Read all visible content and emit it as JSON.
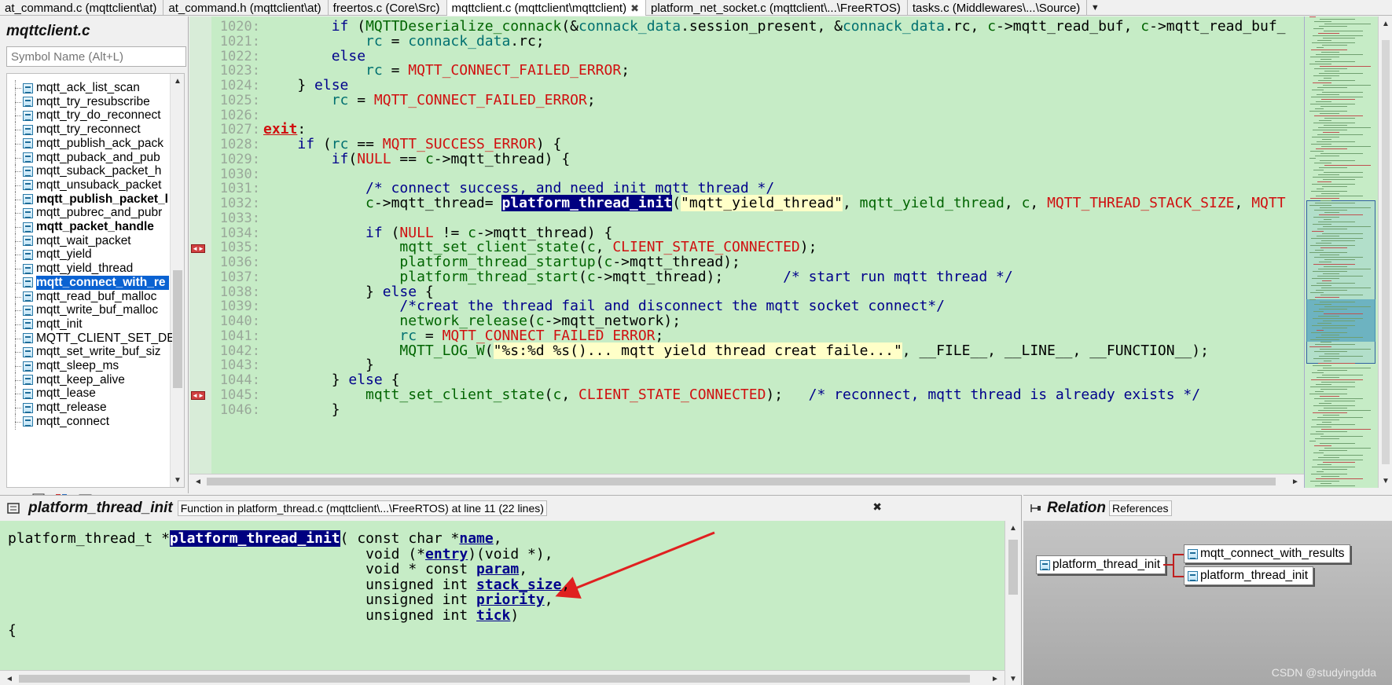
{
  "tabs": [
    {
      "label": "at_command.c (mqttclient\\at)",
      "active": false
    },
    {
      "label": "at_command.h (mqttclient\\at)",
      "active": false
    },
    {
      "label": "freertos.c (Core\\Src)",
      "active": false
    },
    {
      "label": "mqttclient.c (mqttclient\\mqttclient)",
      "active": true
    },
    {
      "label": "platform_net_socket.c (mqttclient\\...\\FreeRTOS)",
      "active": false
    },
    {
      "label": "tasks.c (Middlewares\\...\\Source)",
      "active": false
    }
  ],
  "tab_close_glyph": "✖",
  "tab_more_glyph": "▼",
  "symbol_panel": {
    "title": "mqttclient.c",
    "search_placeholder": "Symbol Name (Alt+L)",
    "items": [
      {
        "label": "mqtt_ack_list_scan",
        "bold": false,
        "selected": false
      },
      {
        "label": "mqtt_try_resubscribe",
        "bold": false,
        "selected": false
      },
      {
        "label": "mqtt_try_do_reconnect",
        "bold": false,
        "selected": false
      },
      {
        "label": "mqtt_try_reconnect",
        "bold": false,
        "selected": false
      },
      {
        "label": "mqtt_publish_ack_pack",
        "bold": false,
        "selected": false
      },
      {
        "label": "mqtt_puback_and_pub",
        "bold": false,
        "selected": false
      },
      {
        "label": "mqtt_suback_packet_h",
        "bold": false,
        "selected": false
      },
      {
        "label": "mqtt_unsuback_packet",
        "bold": false,
        "selected": false
      },
      {
        "label": "mqtt_publish_packet_l",
        "bold": true,
        "selected": false
      },
      {
        "label": "mqtt_pubrec_and_pubr",
        "bold": false,
        "selected": false
      },
      {
        "label": "mqtt_packet_handle",
        "bold": true,
        "selected": false
      },
      {
        "label": "mqtt_wait_packet",
        "bold": false,
        "selected": false
      },
      {
        "label": "mqtt_yield",
        "bold": false,
        "selected": false
      },
      {
        "label": "mqtt_yield_thread",
        "bold": false,
        "selected": false
      },
      {
        "label": "mqtt_connect_with_re",
        "bold": true,
        "selected": true
      },
      {
        "label": "mqtt_read_buf_malloc",
        "bold": false,
        "selected": false
      },
      {
        "label": "mqtt_write_buf_malloc",
        "bold": false,
        "selected": false
      },
      {
        "label": "mqtt_init",
        "bold": false,
        "selected": false
      },
      {
        "label": "MQTT_CLIENT_SET_DEF",
        "bold": false,
        "selected": false
      },
      {
        "label": "mqtt_set_write_buf_siz",
        "bold": false,
        "selected": false
      },
      {
        "label": "mqtt_sleep_ms",
        "bold": false,
        "selected": false
      },
      {
        "label": "mqtt_keep_alive",
        "bold": false,
        "selected": false
      },
      {
        "label": "mqtt_lease",
        "bold": false,
        "selected": false
      },
      {
        "label": "mqtt_release",
        "bold": false,
        "selected": false
      },
      {
        "label": "mqtt_connect",
        "bold": false,
        "selected": false
      }
    ],
    "toolbar": {
      "az_label": "A-Z"
    }
  },
  "editor": {
    "lines": [
      {
        "n": "1020:",
        "segs": [
          [
            "txt",
            "        "
          ],
          [
            "kw",
            "if"
          ],
          [
            "txt",
            " ("
          ],
          [
            "fn",
            "MQTTDeserialize_connack"
          ],
          [
            "txt",
            "(&"
          ],
          [
            "var",
            "connack_data"
          ],
          [
            "txt",
            ".session_present, &"
          ],
          [
            "var",
            "connack_data"
          ],
          [
            "txt",
            ".rc, "
          ],
          [
            "fn",
            "c"
          ],
          [
            "txt",
            "->mqtt_read_buf, "
          ],
          [
            "fn",
            "c"
          ],
          [
            "txt",
            "->mqtt_read_buf_"
          ]
        ]
      },
      {
        "n": "1021:",
        "segs": [
          [
            "txt",
            "            "
          ],
          [
            "var",
            "rc"
          ],
          [
            "txt",
            " = "
          ],
          [
            "var",
            "connack_data"
          ],
          [
            "txt",
            ".rc;"
          ]
        ]
      },
      {
        "n": "1022:",
        "segs": [
          [
            "txt",
            "        "
          ],
          [
            "kw",
            "else"
          ]
        ]
      },
      {
        "n": "1023:",
        "segs": [
          [
            "txt",
            "            "
          ],
          [
            "var",
            "rc"
          ],
          [
            "txt",
            " = "
          ],
          [
            "mac",
            "MQTT_CONNECT_FAILED_ERROR"
          ],
          [
            "txt",
            ";"
          ]
        ]
      },
      {
        "n": "1024:",
        "segs": [
          [
            "txt",
            "    } "
          ],
          [
            "kw",
            "else"
          ]
        ]
      },
      {
        "n": "1025:",
        "segs": [
          [
            "txt",
            "        "
          ],
          [
            "var",
            "rc"
          ],
          [
            "txt",
            " = "
          ],
          [
            "mac",
            "MQTT_CONNECT_FAILED_ERROR"
          ],
          [
            "txt",
            ";"
          ]
        ]
      },
      {
        "n": "1026:",
        "segs": [
          [
            "txt",
            ""
          ]
        ]
      },
      {
        "n": "1027:",
        "segs": [
          [
            "lbl",
            "exit"
          ],
          [
            "txt",
            ":"
          ]
        ]
      },
      {
        "n": "1028:",
        "segs": [
          [
            "txt",
            "    "
          ],
          [
            "kw",
            "if"
          ],
          [
            "txt",
            " ("
          ],
          [
            "var",
            "rc"
          ],
          [
            "txt",
            " == "
          ],
          [
            "mac",
            "MQTT_SUCCESS_ERROR"
          ],
          [
            "txt",
            ") {"
          ]
        ]
      },
      {
        "n": "1029:",
        "segs": [
          [
            "txt",
            "        "
          ],
          [
            "kw",
            "if"
          ],
          [
            "txt",
            "("
          ],
          [
            "mac",
            "NULL"
          ],
          [
            "txt",
            " == "
          ],
          [
            "fn",
            "c"
          ],
          [
            "txt",
            "->mqtt_thread) {"
          ]
        ]
      },
      {
        "n": "1030:",
        "segs": [
          [
            "txt",
            ""
          ]
        ]
      },
      {
        "n": "1031:",
        "segs": [
          [
            "txt",
            "            "
          ],
          [
            "cmt",
            "/* connect success, and need init mqtt thread */"
          ]
        ]
      },
      {
        "n": "1032:",
        "segs": [
          [
            "txt",
            "            "
          ],
          [
            "fn",
            "c"
          ],
          [
            "txt",
            "->mqtt_thread= "
          ],
          [
            "hl",
            "platform_thread_init"
          ],
          [
            "txt",
            "("
          ],
          [
            "str",
            "\"mqtt_yield_thread\""
          ],
          [
            "txt",
            ", "
          ],
          [
            "fn",
            "mqtt_yield_thread"
          ],
          [
            "txt",
            ", "
          ],
          [
            "fn",
            "c"
          ],
          [
            "txt",
            ", "
          ],
          [
            "mac",
            "MQTT_THREAD_STACK_SIZE"
          ],
          [
            "txt",
            ", "
          ],
          [
            "mac",
            "MQTT"
          ]
        ]
      },
      {
        "n": "1033:",
        "segs": [
          [
            "txt",
            ""
          ]
        ]
      },
      {
        "n": "1034:",
        "segs": [
          [
            "txt",
            "            "
          ],
          [
            "kw",
            "if"
          ],
          [
            "txt",
            " ("
          ],
          [
            "mac",
            "NULL"
          ],
          [
            "txt",
            " != "
          ],
          [
            "fn",
            "c"
          ],
          [
            "txt",
            "->mqtt_thread) {"
          ]
        ]
      },
      {
        "n": "1035:",
        "segs": [
          [
            "txt",
            "                "
          ],
          [
            "fn",
            "mqtt_set_client_state"
          ],
          [
            "txt",
            "("
          ],
          [
            "fn",
            "c"
          ],
          [
            "txt",
            ", "
          ],
          [
            "mac",
            "CLIENT_STATE_CONNECTED"
          ],
          [
            "txt",
            ");"
          ]
        ]
      },
      {
        "n": "1036:",
        "segs": [
          [
            "txt",
            "                "
          ],
          [
            "fn",
            "platform_thread_startup"
          ],
          [
            "txt",
            "("
          ],
          [
            "fn",
            "c"
          ],
          [
            "txt",
            "->mqtt_thread);"
          ]
        ]
      },
      {
        "n": "1037:",
        "segs": [
          [
            "txt",
            "                "
          ],
          [
            "fn",
            "platform_thread_start"
          ],
          [
            "txt",
            "("
          ],
          [
            "fn",
            "c"
          ],
          [
            "txt",
            "->mqtt_thread);       "
          ],
          [
            "cmt",
            "/* start run mqtt thread */"
          ]
        ]
      },
      {
        "n": "1038:",
        "segs": [
          [
            "txt",
            "            } "
          ],
          [
            "kw",
            "else"
          ],
          [
            "txt",
            " {"
          ]
        ]
      },
      {
        "n": "1039:",
        "segs": [
          [
            "txt",
            "                "
          ],
          [
            "cmt",
            "/*creat the thread fail and disconnect the mqtt socket connect*/"
          ]
        ]
      },
      {
        "n": "1040:",
        "segs": [
          [
            "txt",
            "                "
          ],
          [
            "fn",
            "network_release"
          ],
          [
            "txt",
            "("
          ],
          [
            "fn",
            "c"
          ],
          [
            "txt",
            "->mqtt_network);"
          ]
        ]
      },
      {
        "n": "1041:",
        "segs": [
          [
            "txt",
            "                "
          ],
          [
            "var",
            "rc"
          ],
          [
            "txt",
            " = "
          ],
          [
            "mac",
            "MQTT_CONNECT_FAILED_ERROR"
          ],
          [
            "txt",
            ";"
          ]
        ]
      },
      {
        "n": "1042:",
        "segs": [
          [
            "txt",
            "                "
          ],
          [
            "fn",
            "MQTT_LOG_W"
          ],
          [
            "txt",
            "("
          ],
          [
            "str",
            "\"%s:%d %s()... mqtt yield thread creat faile...\""
          ],
          [
            "txt",
            ", __FILE__, __LINE__, __FUNCTION__);"
          ]
        ]
      },
      {
        "n": "1043:",
        "segs": [
          [
            "txt",
            "            }"
          ]
        ]
      },
      {
        "n": "1044:",
        "segs": [
          [
            "txt",
            "        } "
          ],
          [
            "kw",
            "else"
          ],
          [
            "txt",
            " {"
          ]
        ]
      },
      {
        "n": "1045:",
        "segs": [
          [
            "txt",
            "            "
          ],
          [
            "fn",
            "mqtt_set_client_state"
          ],
          [
            "txt",
            "("
          ],
          [
            "fn",
            "c"
          ],
          [
            "txt",
            ", "
          ],
          [
            "mac",
            "CLIENT_STATE_CONNECTED"
          ],
          [
            "txt",
            ");   "
          ],
          [
            "cmt",
            "/* reconnect, mqtt thread is already exists */"
          ]
        ]
      },
      {
        "n": "1046:",
        "segs": [
          [
            "txt",
            "        }"
          ]
        ]
      }
    ],
    "breakpoint_glyph": "◄►"
  },
  "context": {
    "name": "platform_thread_init",
    "description": "Function in platform_thread.c (mqttclient\\...\\FreeRTOS) at line 11 (22 lines)",
    "close_glyph": "✖",
    "lines": [
      [
        [
          "txt",
          "platform_thread_t *"
        ],
        [
          "hl",
          "platform_thread_init"
        ],
        [
          "txt",
          "( const char *"
        ],
        [
          "param",
          "name"
        ],
        [
          "txt",
          ","
        ]
      ],
      [
        [
          "txt",
          "                                          void (*"
        ],
        [
          "param",
          "entry"
        ],
        [
          "txt",
          ")(void *),"
        ]
      ],
      [
        [
          "txt",
          "                                          void * const "
        ],
        [
          "param",
          "param"
        ],
        [
          "txt",
          ","
        ]
      ],
      [
        [
          "txt",
          "                                          unsigned int "
        ],
        [
          "param",
          "stack_size"
        ],
        [
          "txt",
          ","
        ]
      ],
      [
        [
          "txt",
          "                                          unsigned int "
        ],
        [
          "param",
          "priority"
        ],
        [
          "txt",
          ","
        ]
      ],
      [
        [
          "txt",
          "                                          unsigned int "
        ],
        [
          "param",
          "tick"
        ],
        [
          "txt",
          ")"
        ]
      ],
      [
        [
          "txt",
          "{"
        ]
      ]
    ]
  },
  "relation": {
    "title": "Relation",
    "tab": "References",
    "root": "platform_thread_init",
    "children": [
      "mqtt_connect_with_results",
      "platform_thread_init"
    ]
  },
  "watermark": "CSDN @studyingdda",
  "arrow_color": "#e02020"
}
